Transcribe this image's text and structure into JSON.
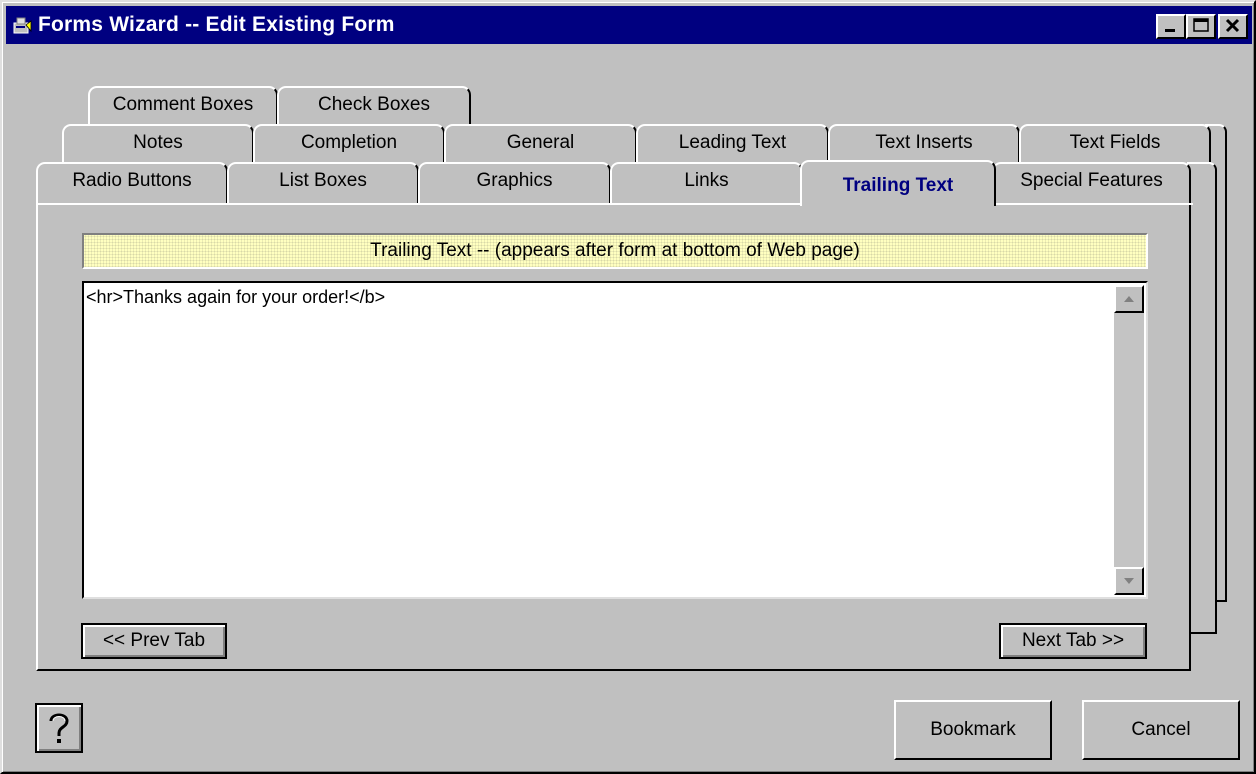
{
  "window": {
    "title": "Forms Wizard -- Edit Existing Form",
    "controls": {
      "minimize": "_",
      "maximize": "□",
      "close": "✕"
    },
    "icon": "wizard-app-icon"
  },
  "tabs": {
    "row_back": [
      "Comment Boxes",
      "Check Boxes"
    ],
    "row_middle": [
      "Notes",
      "Completion",
      "General",
      "Leading Text",
      "Text Inserts",
      "Text Fields"
    ],
    "row_front": [
      "Radio Buttons",
      "List Boxes",
      "Graphics",
      "Links",
      "Trailing Text",
      "Special Features"
    ],
    "active": "Trailing Text"
  },
  "panel": {
    "header": "Trailing Text -- (appears after form at bottom of Web page)",
    "textarea_value": "<hr>Thanks again for your order!</b>",
    "prev_label": "<< Prev Tab",
    "next_label": "Next Tab >>"
  },
  "footer": {
    "help_icon": "question-mark-icon",
    "bookmark_label": "Bookmark",
    "cancel_label": "Cancel"
  },
  "colors": {
    "face": "#c0c0c0",
    "titlebar": "#000080",
    "active_tab_text": "#000080",
    "header_bg": "#ffffc0"
  }
}
